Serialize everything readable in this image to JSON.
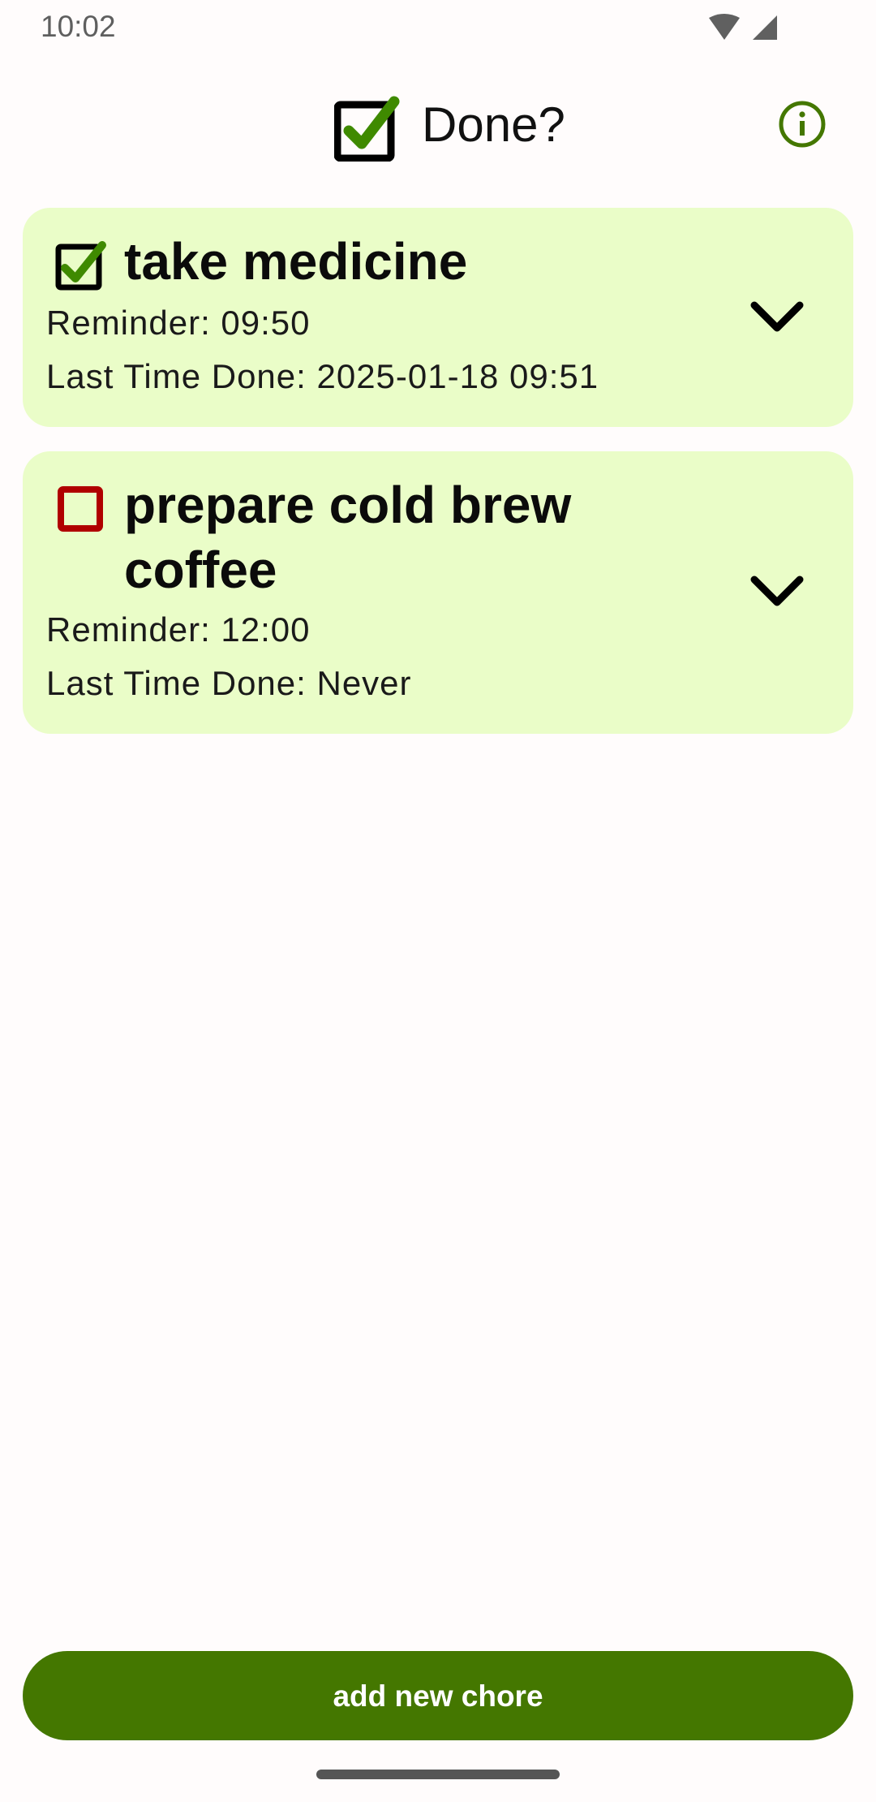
{
  "status_bar": {
    "time": "10:02",
    "icons": [
      "wifi-icon",
      "signal-icon"
    ]
  },
  "header": {
    "title": "Done?",
    "logo_icon": "checked-box-icon",
    "info_icon": "info-icon"
  },
  "chores": [
    {
      "title": "take medicine",
      "done": true,
      "status_icon": "checked-box-icon",
      "reminder": "Reminder: 09:50",
      "last_done": "Last Time Done: 2025-01-18 09:51",
      "expand_icon": "chevron-down-icon"
    },
    {
      "title": "prepare cold brew coffee",
      "done": false,
      "status_icon": "unchecked-box-icon",
      "reminder": "Reminder: 12:00",
      "last_done": "Last Time Done: Never",
      "expand_icon": "chevron-down-icon"
    }
  ],
  "add_button": {
    "label": "add new chore"
  },
  "colors": {
    "accent": "#447700",
    "card_background": "#eafdc8",
    "done_check": "#3f8a00",
    "undone_box": "#b00000",
    "background": "#fffcfc"
  }
}
